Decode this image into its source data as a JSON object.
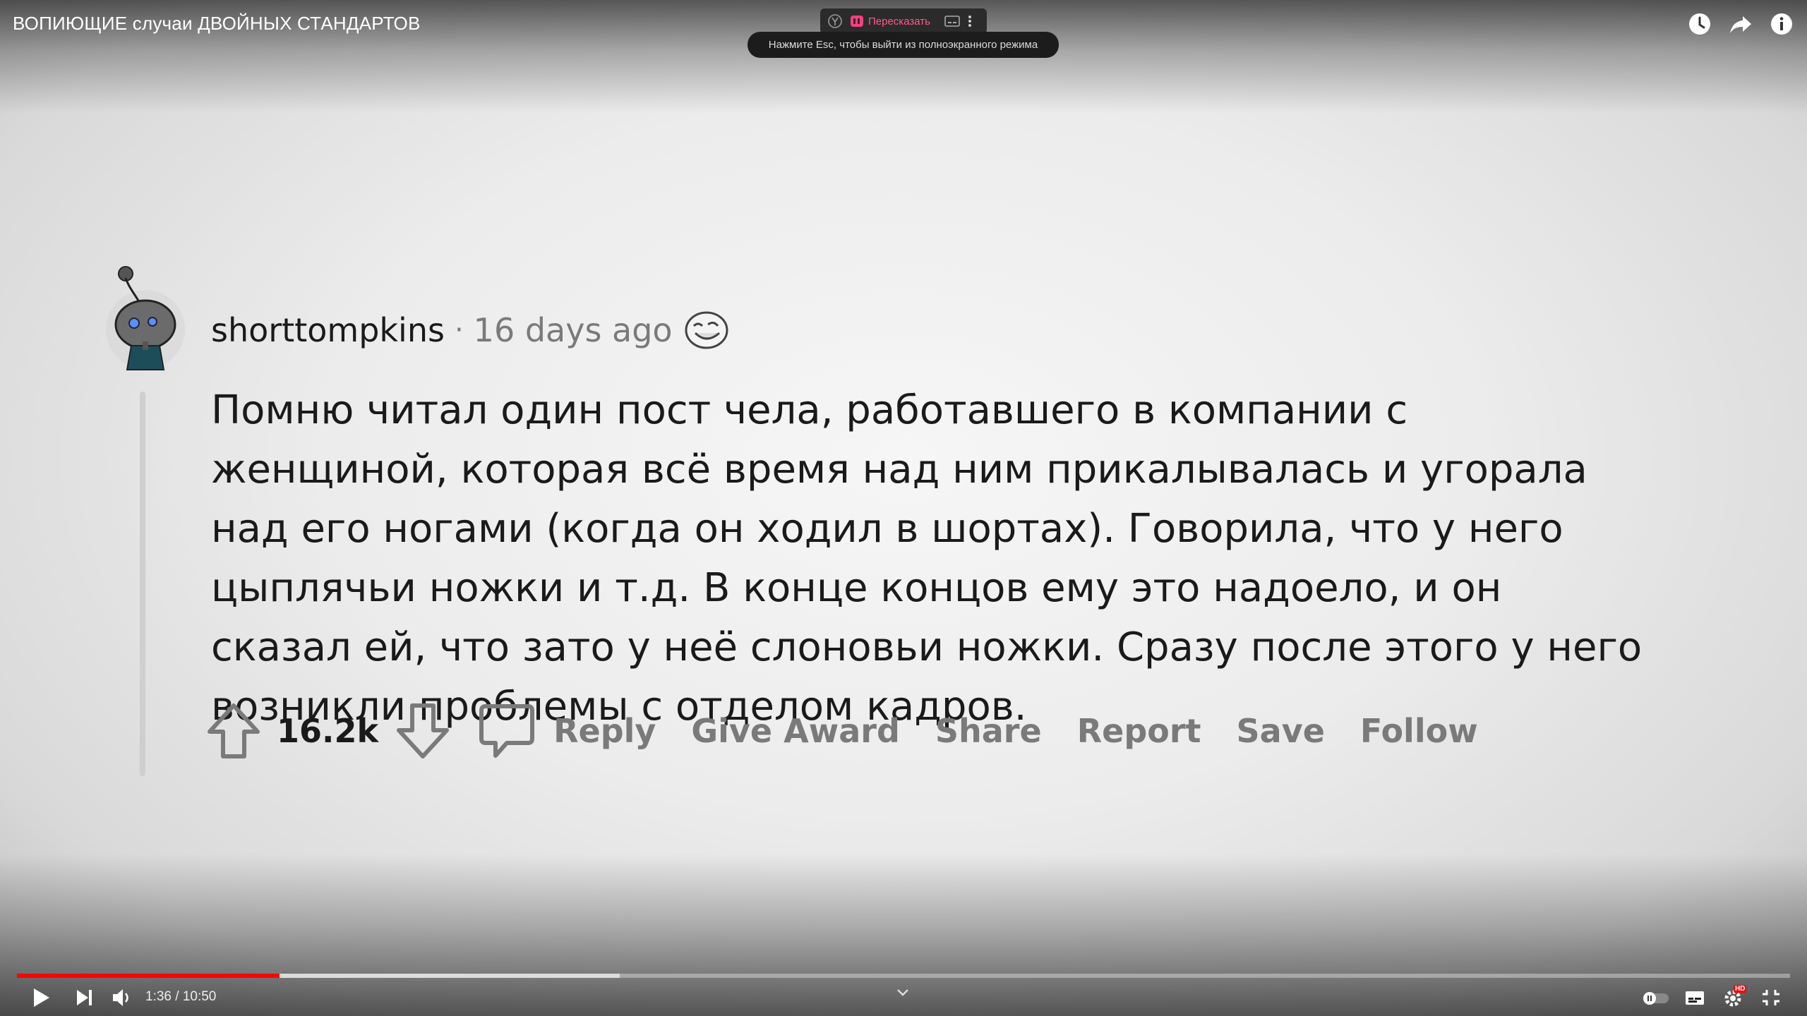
{
  "video": {
    "title": "ВОПИЮЩИЕ случаи ДВОЙНЫХ СТАНДАРТОВ"
  },
  "browser_toolbar": {
    "retell_label": "Пересказать",
    "esc_hint": "Нажмите Esc, чтобы выйти из полноэкранного режима"
  },
  "comment": {
    "username": "shorttompkins",
    "separator": "·",
    "age": "16 days ago",
    "body": "Помню читал один пост чела, работавшего в компании с женщиной, которая всё время над ним прикалывалась и угорала над его ногами (когда он ходил в шортах). Говорила, что у него цыплячьи ножки и т.д. В конце концов ему это надоело, и он сказал ей, что зато у неё слоновьи ножки. Сразу после этого у него возникли проблемы с отделом кадров.",
    "score": "16.2k",
    "actions": {
      "reply": "Reply",
      "give_award": "Give Award",
      "share": "Share",
      "report": "Report",
      "save": "Save",
      "follow": "Follow"
    }
  },
  "player": {
    "time": "1:36 / 10:50",
    "played_fraction": 0.148,
    "buffered_fraction": 0.34,
    "hd_badge": "HD",
    "accent_color": "#ff0000"
  },
  "icons": {
    "top": [
      "clock-icon",
      "share-arrow-icon",
      "info-icon"
    ],
    "bottom": [
      "play-icon",
      "next-icon",
      "volume-icon",
      "autoplay-toggle-icon",
      "subtitles-icon",
      "settings-icon",
      "exit-fullscreen-icon"
    ]
  }
}
